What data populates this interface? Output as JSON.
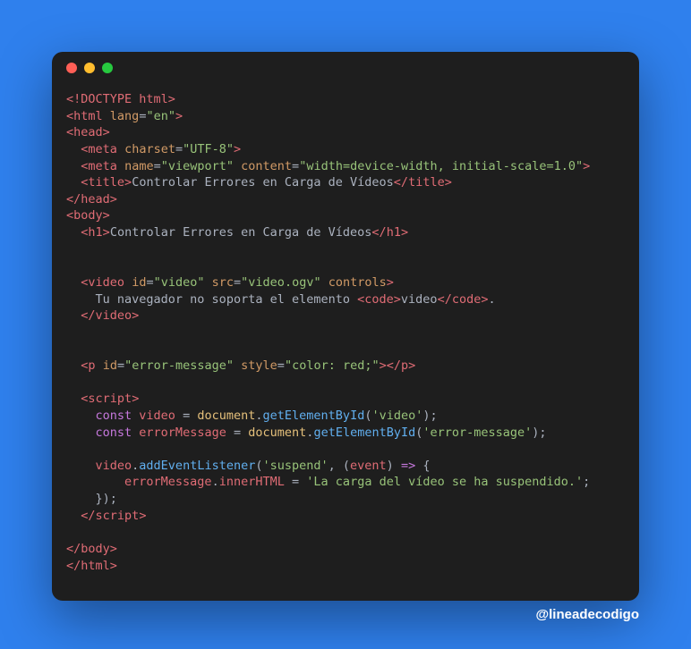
{
  "attribution": "@lineadecodigo",
  "code": {
    "doctype": "<!DOCTYPE html>",
    "htmlTag": "html",
    "lang": {
      "attr": "lang",
      "val": "\"en\""
    },
    "headTag": "head",
    "meta1": {
      "tag": "meta",
      "a1": "charset",
      "v1": "\"UTF-8\""
    },
    "meta2": {
      "tag": "meta",
      "a1": "name",
      "v1": "\"viewport\"",
      "a2": "content",
      "v2": "\"width=device-width, initial-scale=1.0\""
    },
    "titleTag": "title",
    "titleText": "Controlar Errores en Carga de Vídeos",
    "bodyTag": "body",
    "h1Tag": "h1",
    "h1Text": "Controlar Errores en Carga de Vídeos",
    "videoTag": "video",
    "videoId": {
      "attr": "id",
      "val": "\"video\""
    },
    "videoSrc": {
      "attr": "src",
      "val": "\"video.ogv\""
    },
    "videoCtrl": "controls",
    "fallback1": "Tu navegador no soporta el elemento ",
    "codeTag": "code",
    "codeInner": "video",
    "fallback2": ".",
    "pTag": "p",
    "pId": {
      "attr": "id",
      "val": "\"error-message\""
    },
    "pStyle": {
      "attr": "style",
      "val": "\"color: red;\""
    },
    "scriptTag": "script",
    "kwConst": "const",
    "var1": "video",
    "obj": "document",
    "fnGet": "getElementById",
    "argVideo": "'video'",
    "var2": "errorMessage",
    "argError": "'error-message'",
    "fnListen": "addEventListener",
    "argSuspend": "'suspend'",
    "paramEvent": "event",
    "arrow": "=>",
    "propInner": "innerHTML",
    "msg": "'La carga del vídeo se ha suspendido.'"
  }
}
